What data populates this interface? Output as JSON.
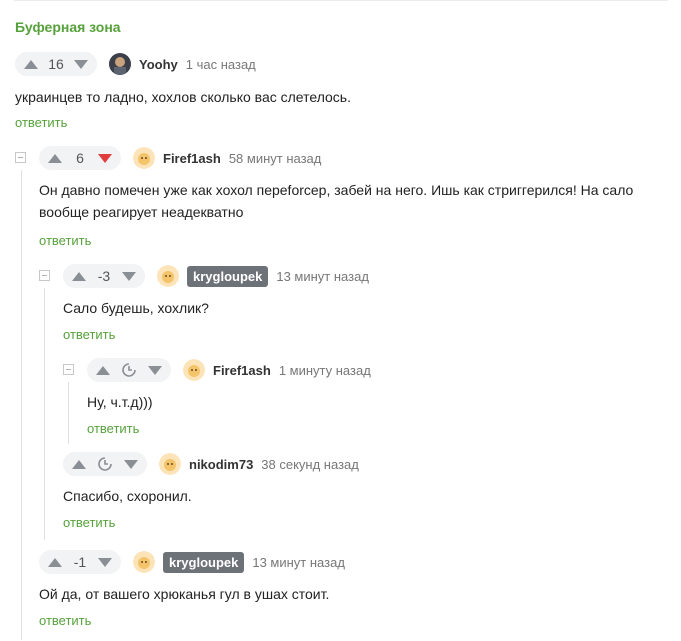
{
  "section_title": "Буферная зона",
  "reply_label": "ответить",
  "comments": [
    {
      "score": "16",
      "author": "Yoohy",
      "time": "1 час назад",
      "text": "украинцев то ладно, хохлов сколько вас слетелось."
    },
    {
      "score": "6",
      "author": "Firef1ash",
      "time": "58 минут назад",
      "text": "Он давно помечен уже как хохол переforcep, забей на него. Ишь как стриггерился! На сало вообще реагирует неадекватно"
    },
    {
      "score": "-3",
      "author": "krygloupek",
      "time": "13 минут назад",
      "text": "Сало будешь, хохлик?"
    },
    {
      "score": "",
      "author": "Firef1ash",
      "time": "1 минуту назад",
      "text": "Ну, ч.т.д)))"
    },
    {
      "score": "",
      "author": "nikodim73",
      "time": "38 секунд назад",
      "text": "Спасибо, схоронил."
    },
    {
      "score": "-1",
      "author": "krygloupek",
      "time": "13 минут назад",
      "text": "Ой да, от вашего хрюканья гул в ушах стоит."
    }
  ],
  "colors": {
    "accent": "#56a13b",
    "downvote_active": "#e23d3d",
    "author_tag_bg": "#6d7178"
  },
  "icons": [
    "upvote-icon",
    "downvote-icon",
    "clock-icon",
    "collapse-icon",
    "avatar-icon"
  ]
}
